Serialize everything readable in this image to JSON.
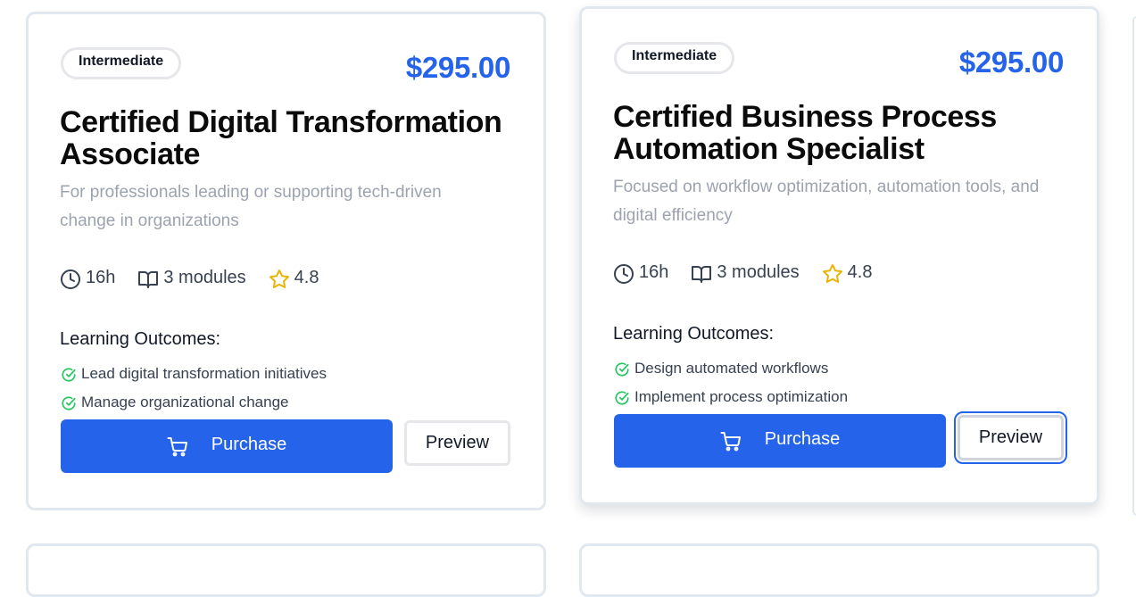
{
  "courses": [
    {
      "level": "Intermediate",
      "price": "$295.00",
      "title": "Certified Digital Transformation Associate",
      "description": "For professionals leading or supporting tech-driven change in organizations",
      "duration": "16h",
      "modules": "3 modules",
      "rating": "4.8",
      "outcomes_title": "Learning Outcomes:",
      "outcomes": [
        "Lead digital transformation initiatives",
        "Manage organizational change"
      ],
      "purchase_label": "Purchase",
      "preview_label": "Preview"
    },
    {
      "level": "Intermediate",
      "price": "$295.00",
      "title": "Certified Business Process Automation Specialist",
      "description": "Focused on workflow optimization, automation tools, and digital efficiency",
      "duration": "16h",
      "modules": "3 modules",
      "rating": "4.8",
      "outcomes_title": "Learning Outcomes:",
      "outcomes": [
        "Design automated workflows",
        "Implement process optimization"
      ],
      "purchase_label": "Purchase",
      "preview_label": "Preview"
    }
  ],
  "colors": {
    "accent": "#2563eb",
    "rating_star": "#eab308",
    "check": "#22c55e",
    "muted_text": "#9ca3af",
    "card_border": "#e2e8f0"
  },
  "icons": {
    "duration": "clock-icon",
    "modules": "book-open-icon",
    "rating": "star-icon",
    "outcome": "check-circle-icon",
    "purchase": "shopping-cart-icon"
  }
}
